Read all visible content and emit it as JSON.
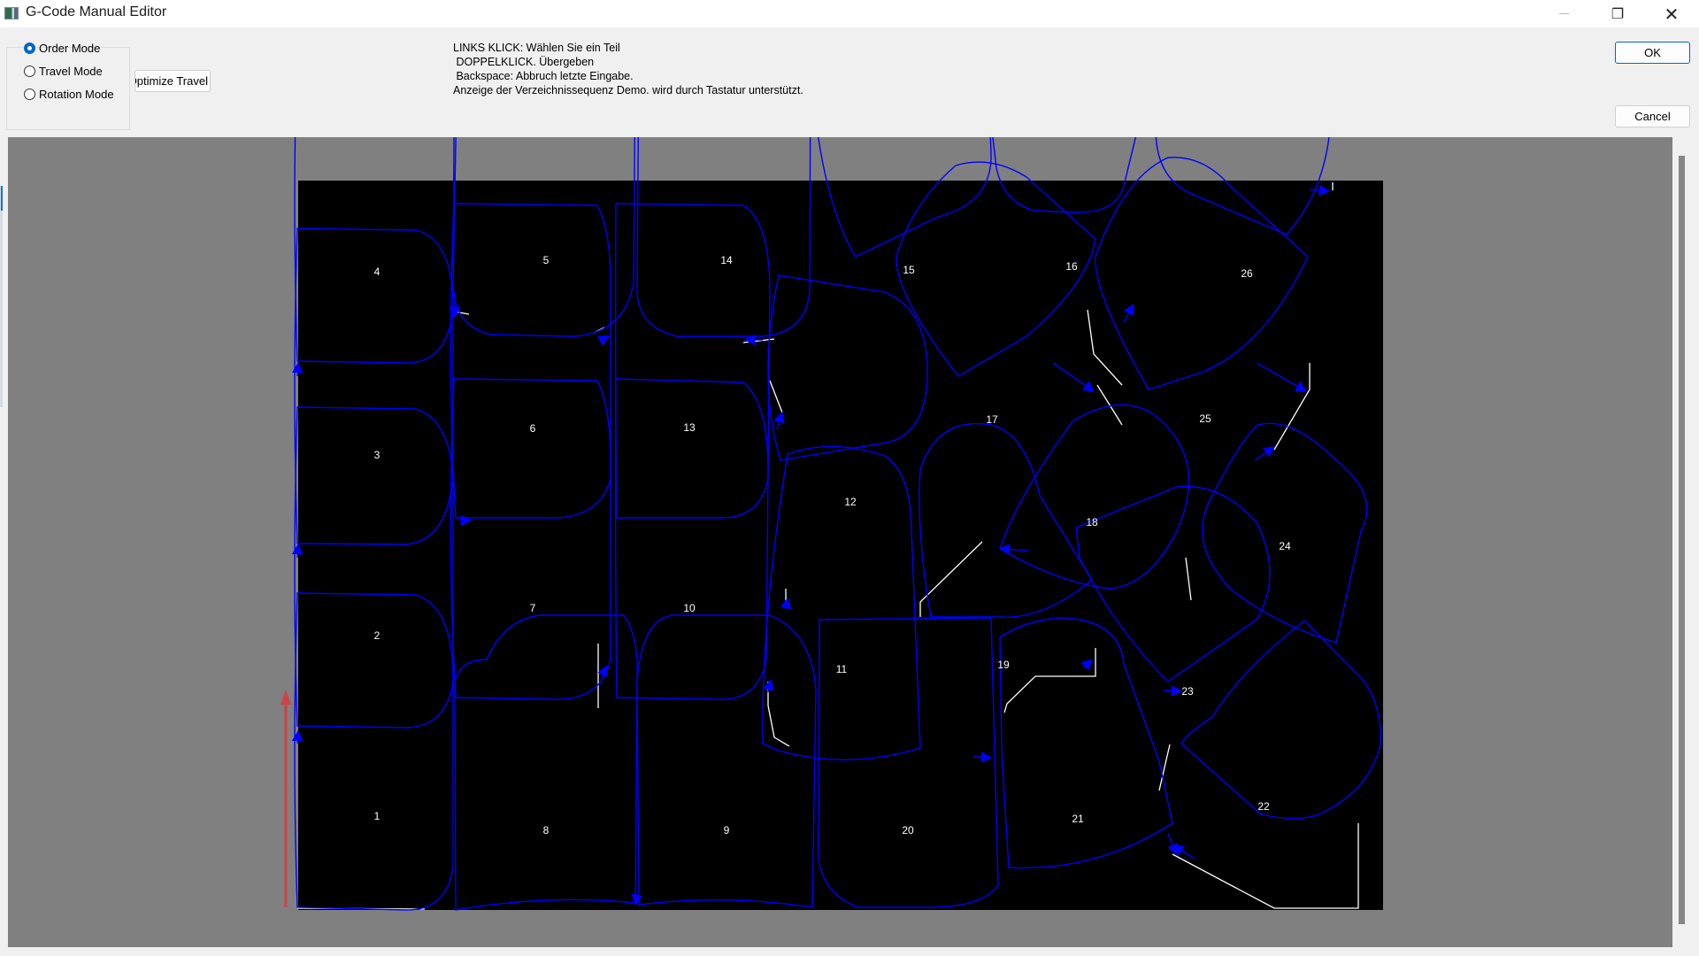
{
  "window": {
    "title": "G-Code Manual Editor",
    "controls": {
      "minimize": "—",
      "restore": "❐",
      "close": "✕"
    }
  },
  "modes": {
    "options": [
      {
        "label": "Order Mode",
        "checked": true
      },
      {
        "label": "Travel Mode",
        "checked": false
      },
      {
        "label": "Rotation Mode",
        "checked": false
      }
    ]
  },
  "buttons": {
    "optimize": "Optimize Travel",
    "ok": "OK",
    "cancel": "Cancel"
  },
  "instructions": [
    "LINKS KLICK: Wählen Sie ein Teil",
    " DOPPELKLICK. Übergeben",
    " Backspace: Abbruch letzte Eingabe.",
    "Anzeige der Verzeichnissequenz Demo. wird durch Tastatur unterstützt."
  ],
  "colors": {
    "plate": "#000000",
    "part_outline": "#0000ff",
    "travel_path": "#ffffff",
    "label": "#ffffff",
    "direction_arrow": "#cc4444",
    "canvas_bg": "#808080"
  },
  "parts": [
    {
      "id": "1",
      "label": "1"
    },
    {
      "id": "2",
      "label": "2"
    },
    {
      "id": "3",
      "label": "3"
    },
    {
      "id": "4",
      "label": "4"
    },
    {
      "id": "5",
      "label": "5"
    },
    {
      "id": "6",
      "label": "6"
    },
    {
      "id": "7",
      "label": "7"
    },
    {
      "id": "8",
      "label": "8"
    },
    {
      "id": "9",
      "label": "9"
    },
    {
      "id": "10",
      "label": "10"
    },
    {
      "id": "11",
      "label": "11"
    },
    {
      "id": "12",
      "label": "12"
    },
    {
      "id": "13",
      "label": "13"
    },
    {
      "id": "14",
      "label": "14"
    },
    {
      "id": "15",
      "label": "15"
    },
    {
      "id": "16",
      "label": "16"
    },
    {
      "id": "17",
      "label": "17"
    },
    {
      "id": "18",
      "label": "18"
    },
    {
      "id": "19",
      "label": "19"
    },
    {
      "id": "20",
      "label": "20"
    },
    {
      "id": "21",
      "label": "21"
    },
    {
      "id": "22",
      "label": "22"
    },
    {
      "id": "23",
      "label": "23"
    },
    {
      "id": "24",
      "label": "24"
    },
    {
      "id": "25",
      "label": "25"
    },
    {
      "id": "26",
      "label": "26"
    }
  ]
}
